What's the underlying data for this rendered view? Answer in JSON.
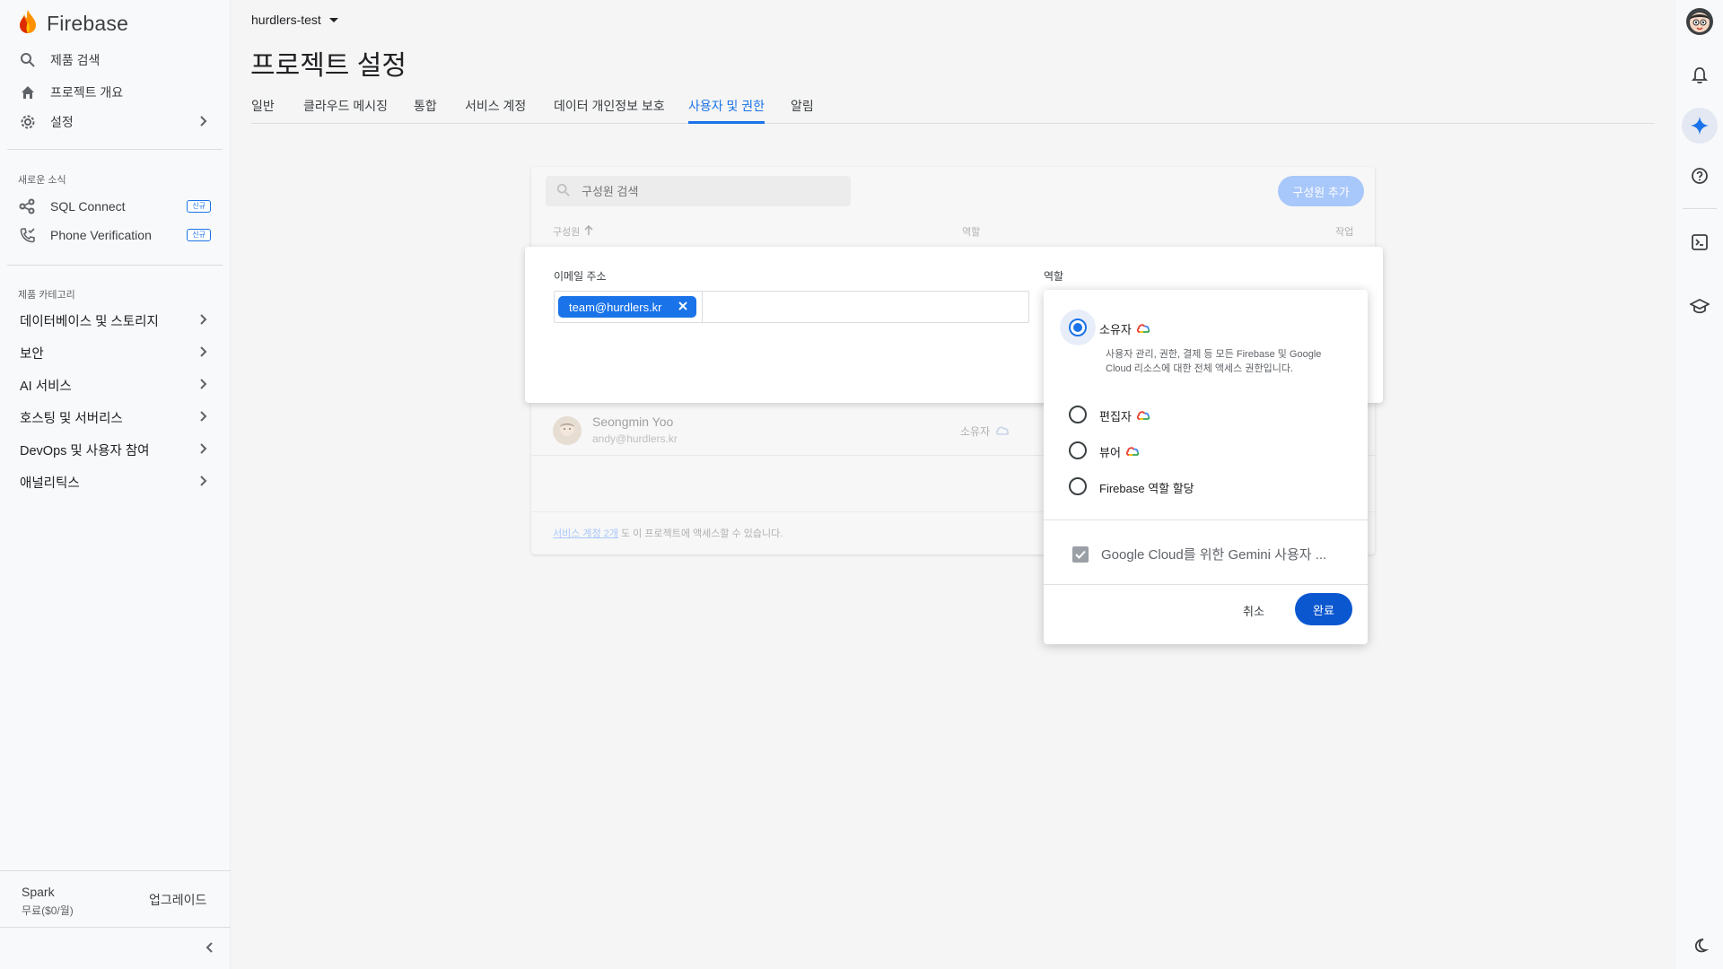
{
  "app": {
    "brand": "Firebase"
  },
  "sidebar": {
    "top_items": [
      {
        "label": "제품 검색",
        "icon": "search-icon"
      },
      {
        "label": "프로젝트 개요",
        "icon": "home-icon"
      },
      {
        "label": "설정",
        "icon": "gear-icon"
      }
    ],
    "news_label": "새로운 소식",
    "news_items": [
      {
        "label": "SQL Connect",
        "badge": "신규"
      },
      {
        "label": "Phone Verification",
        "badge": "신규"
      }
    ],
    "category_label": "제품 카테고리",
    "categories": [
      "데이터베이스 및 스토리지",
      "보안",
      "AI 서비스",
      "호스팅 및 서버리스",
      "DevOps 및 사용자 참여",
      "애널리틱스"
    ],
    "plan_name": "Spark",
    "plan_price": "무료($0/월)",
    "upgrade_label": "업그레이드"
  },
  "header": {
    "project": "hurdlers-test",
    "title": "프로젝트 설정",
    "tabs": [
      "일반",
      "클라우드 메시징",
      "통합",
      "서비스 계정",
      "데이터 개인정보 보호",
      "사용자 및 권한",
      "알림"
    ],
    "active_tab": "사용자 및 권한"
  },
  "members": {
    "search_placeholder": "구성원 검색",
    "add_button": "구성원 추가",
    "col_member": "구성원",
    "col_role": "역할",
    "col_action": "작업",
    "rows": [
      {
        "name": "Seongmin Yoo",
        "email": "andy@hurdlers.kr",
        "role": "소유자"
      }
    ],
    "footer_link": "서비스 계정 2개",
    "footer_text": " 도 이 프로젝트에 액세스할 수 있습니다."
  },
  "dialog": {
    "email_label": "이메일 주소",
    "email_chip": "team@hurdlers.kr",
    "role_label": "역할"
  },
  "role_menu": {
    "options": [
      {
        "label": "소유자",
        "selected": true,
        "cloud_icon": true
      },
      {
        "label": "편집자",
        "selected": false,
        "cloud_icon": true
      },
      {
        "label": "뷰어",
        "selected": false,
        "cloud_icon": true
      },
      {
        "label": "Firebase 역할 할당",
        "selected": false,
        "cloud_icon": false
      }
    ],
    "owner_desc": "사용자 관리, 권한, 결제 등 모든 Firebase 및 Google Cloud 리소스에 대한 전체 액세스 권한입니다.",
    "gemini_label": "Google Cloud를 위한 Gemini 사용자 ...",
    "gemini_checked": true,
    "cancel": "취소",
    "done": "완료"
  },
  "colors": {
    "accent": "#1a73e8",
    "done_button": "#0b57d0",
    "add_button_disabled": "#a8c7fa"
  }
}
